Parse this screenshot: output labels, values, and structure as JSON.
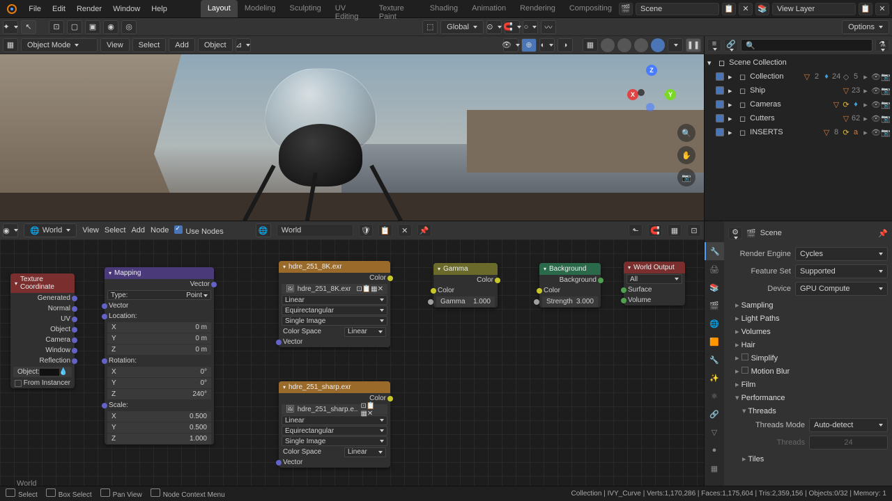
{
  "top_menu": [
    "File",
    "Edit",
    "Render",
    "Window",
    "Help"
  ],
  "workspaces": [
    "Layout",
    "Modeling",
    "Sculpting",
    "UV Editing",
    "Texture Paint",
    "Shading",
    "Animation",
    "Rendering",
    "Compositing"
  ],
  "active_workspace": "Layout",
  "scene_field": "Scene",
  "viewlayer_field": "View Layer",
  "vp_header": {
    "orientation": "Global",
    "options": "Options"
  },
  "obj_header": {
    "mode": "Object Mode",
    "menus": [
      "View",
      "Select",
      "Add",
      "Object"
    ]
  },
  "outliner": {
    "root": "Scene Collection",
    "items": [
      {
        "name": "Collection",
        "badges": [
          "2",
          "24",
          "5"
        ]
      },
      {
        "name": "Ship",
        "badges": [
          "23"
        ]
      },
      {
        "name": "Cameras"
      },
      {
        "name": "Cutters",
        "badges": [
          "62"
        ]
      },
      {
        "name": "INSERTS",
        "badges": [
          "8"
        ]
      }
    ]
  },
  "node_hdr": {
    "type": "World",
    "menus": [
      "View",
      "Select",
      "Add",
      "Node"
    ],
    "use_nodes": "Use Nodes",
    "datablock": "World"
  },
  "nodes": {
    "tex_coord": {
      "title": "Texture Coordinate",
      "outputs": [
        "Generated",
        "Normal",
        "UV",
        "Object",
        "Camera",
        "Window",
        "Reflection"
      ],
      "object_label": "Object:",
      "from_instancer": "From Instancer"
    },
    "mapping": {
      "title": "Mapping",
      "out_vector": "Vector",
      "in_vector": "Vector",
      "type_lbl": "Type:",
      "type_val": "Point",
      "loc_lbl": "Location:",
      "rot_lbl": "Rotation:",
      "scale_lbl": "Scale:",
      "loc": [
        [
          "X",
          "0 m"
        ],
        [
          "Y",
          "0 m"
        ],
        [
          "Z",
          "0 m"
        ]
      ],
      "rot": [
        [
          "X",
          "0°"
        ],
        [
          "Y",
          "0°"
        ],
        [
          "Z",
          "240°"
        ]
      ],
      "scale": [
        [
          "X",
          "0.500"
        ],
        [
          "Y",
          "0.500"
        ],
        [
          "Z",
          "1.000"
        ]
      ]
    },
    "env1": {
      "title": "hdre_251_8K.exr",
      "out_color": "Color",
      "file": "hdre_251_8K.exr",
      "interp": "Linear",
      "proj": "Equirectangular",
      "mode": "Single Image",
      "cs_lbl": "Color Space",
      "cs_val": "Linear",
      "in_vector": "Vector"
    },
    "env2": {
      "title": "hdre_251_sharp.exr",
      "out_color": "Color",
      "file": "hdre_251_sharp.e..",
      "interp": "Linear",
      "proj": "Equirectangular",
      "mode": "Single Image",
      "cs_lbl": "Color Space",
      "cs_val": "Linear",
      "in_vector": "Vector"
    },
    "gamma": {
      "title": "Gamma",
      "out_color": "Color",
      "in_color": "Color",
      "gamma_lbl": "Gamma",
      "gamma_val": "1.000"
    },
    "background": {
      "title": "Background",
      "out_bg": "Background",
      "in_color": "Color",
      "str_lbl": "Strength",
      "str_val": "3.000"
    },
    "world_out": {
      "title": "World Output",
      "target": "All",
      "surface": "Surface",
      "volume": "Volume"
    }
  },
  "node_area_label": "World",
  "props": {
    "header": "Scene",
    "render_engine_lbl": "Render Engine",
    "render_engine": "Cycles",
    "feature_set_lbl": "Feature Set",
    "feature_set": "Supported",
    "device_lbl": "Device",
    "device": "GPU Compute",
    "sections": [
      "Sampling",
      "Light Paths",
      "Volumes",
      "Hair",
      "Simplify",
      "Motion Blur",
      "Film",
      "Performance"
    ],
    "threads_hdr": "Threads",
    "threads_mode_lbl": "Threads Mode",
    "threads_mode": "Auto-detect",
    "threads_lbl": "Threads",
    "threads_val": "24",
    "tiles": "Tiles"
  },
  "status": {
    "select": "Select",
    "box": "Box Select",
    "pan": "Pan View",
    "ctx": "Node Context Menu",
    "info": "Collection | IVY_Curve  | Verts:1,170,286  | Faces:1,175,604  | Tris:2,359,156  | Objects:0/32  | Memory: 1"
  }
}
